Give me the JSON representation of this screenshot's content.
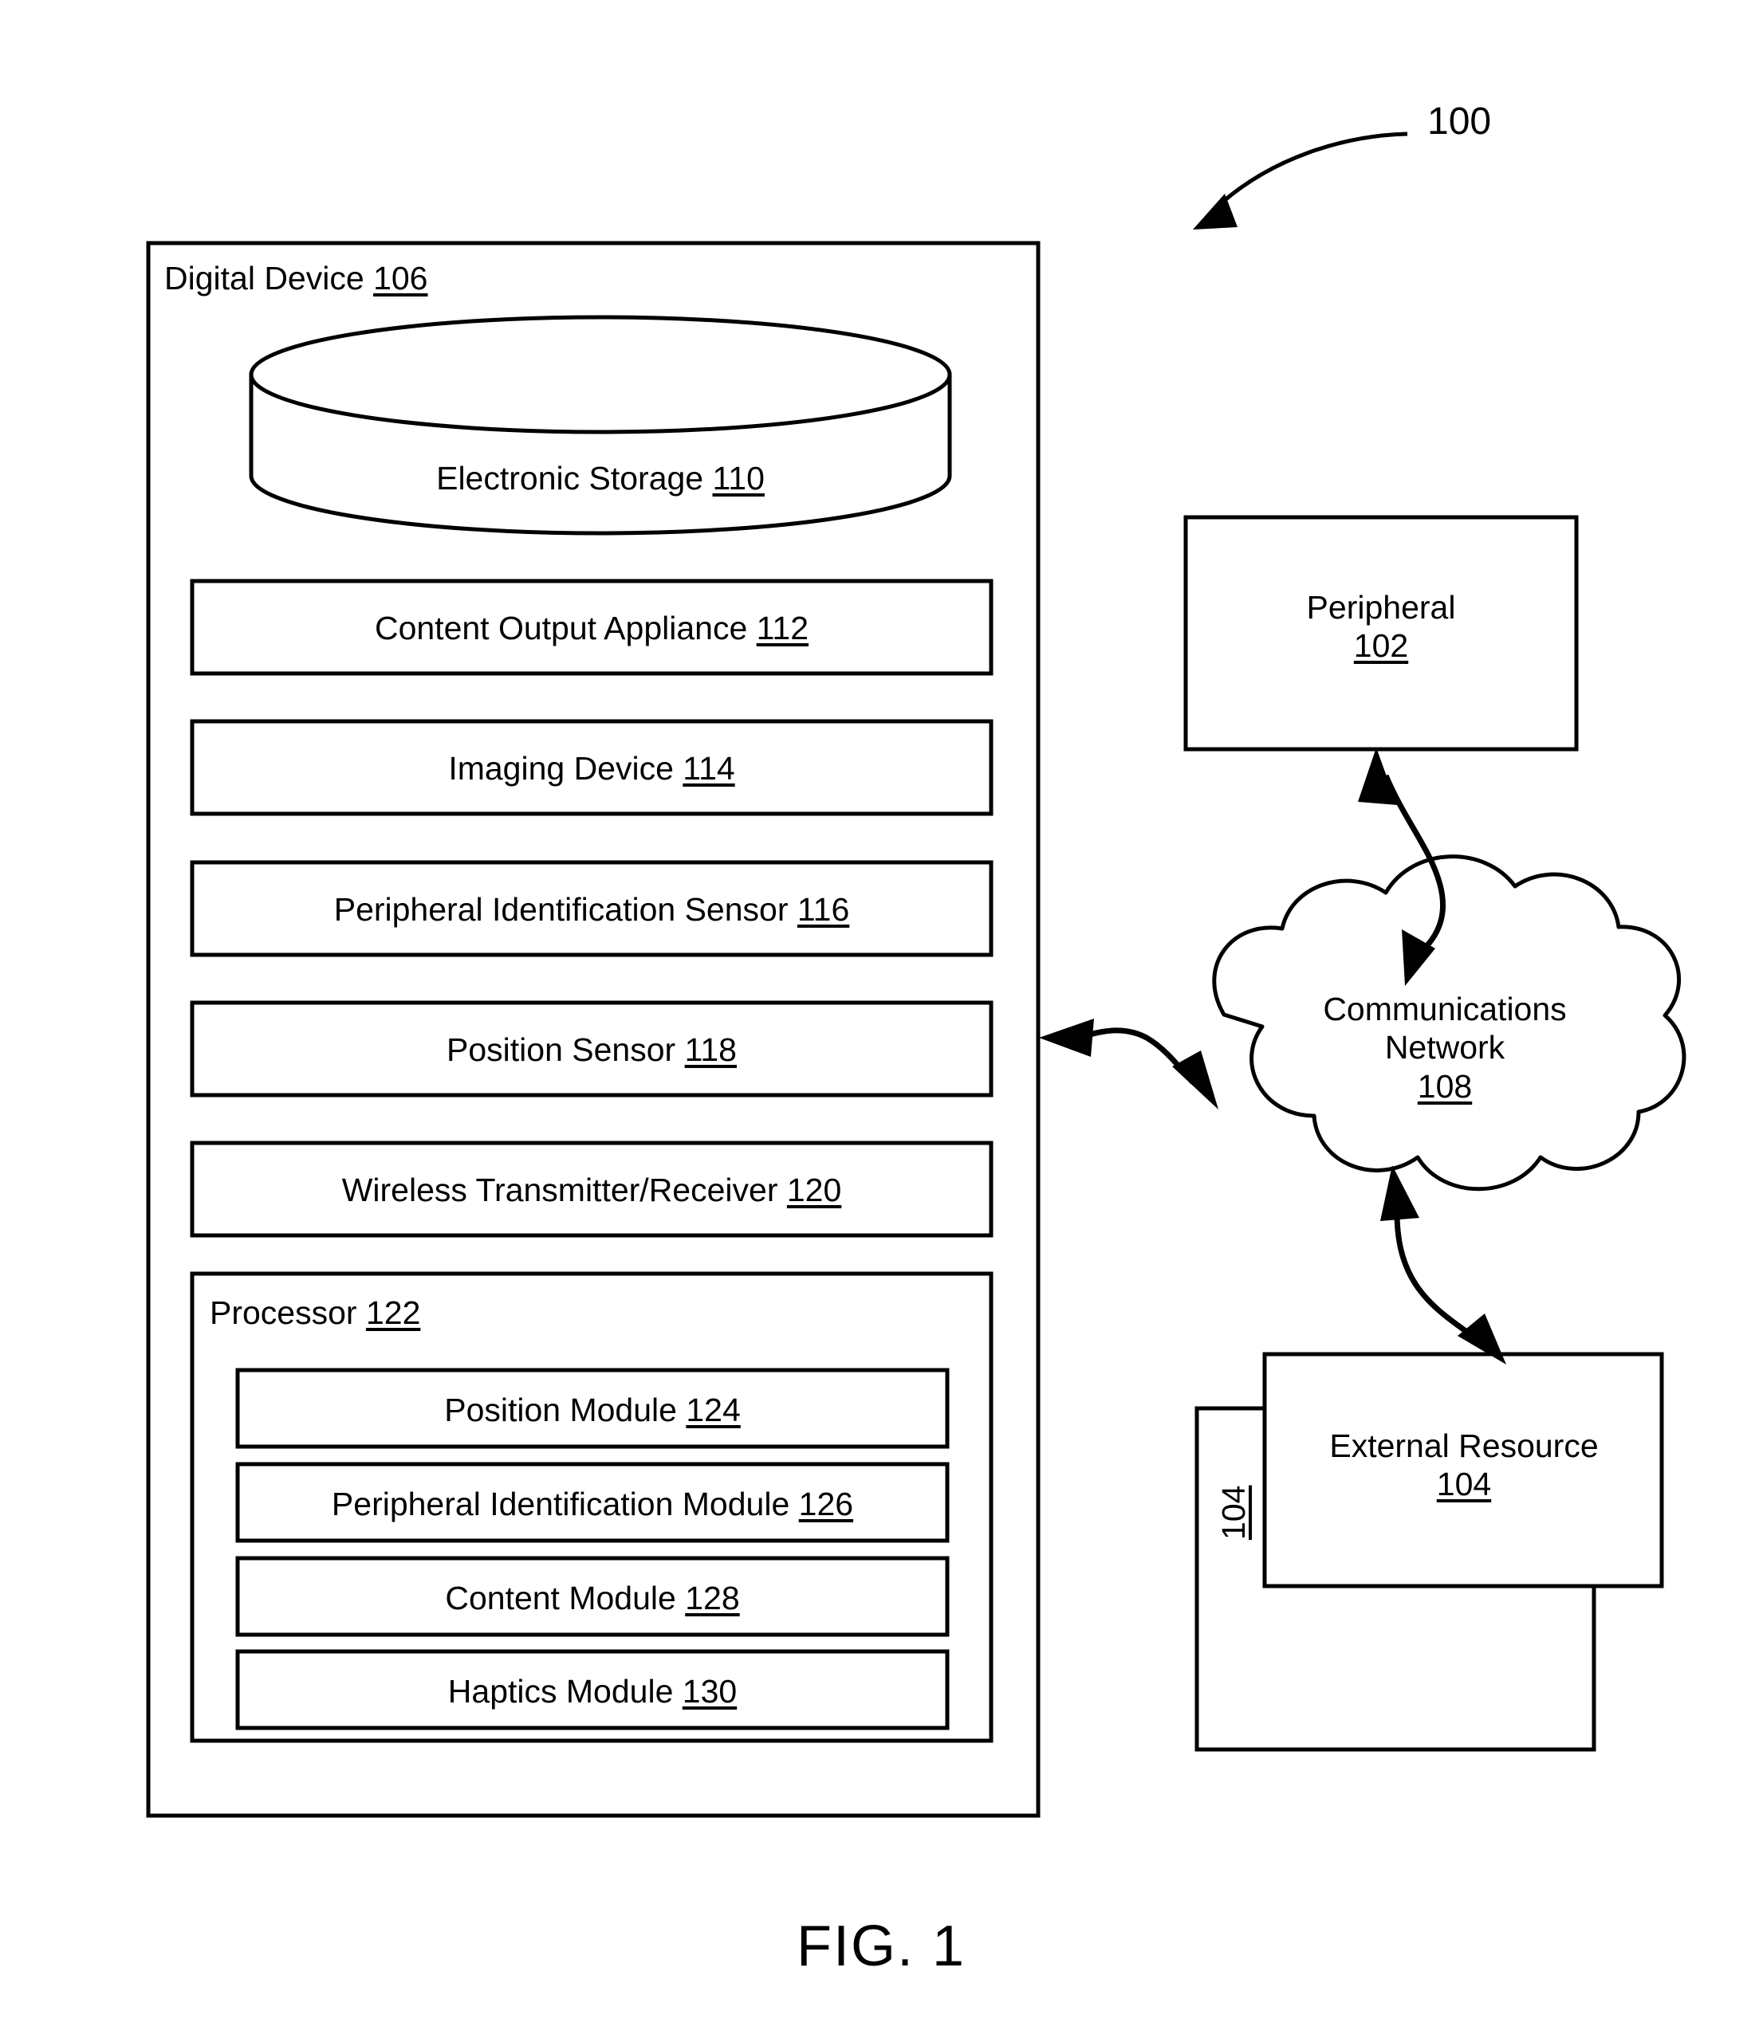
{
  "figure": {
    "caption": "FIG. 1",
    "system_callout": "100"
  },
  "digital_device": {
    "title_text": "Digital Device",
    "title_ref": "106",
    "storage": {
      "label": "Electronic Storage",
      "ref": "110",
      "shape": "cylinder"
    },
    "components": [
      {
        "label": "Content Output Appliance",
        "ref": "112"
      },
      {
        "label": "Imaging Device",
        "ref": "114"
      },
      {
        "label": "Peripheral Identification Sensor",
        "ref": "116"
      },
      {
        "label": "Position Sensor",
        "ref": "118"
      },
      {
        "label": "Wireless Transmitter/Receiver",
        "ref": "120"
      }
    ],
    "processor": {
      "title_text": "Processor",
      "title_ref": "122",
      "modules": [
        {
          "label": "Position Module",
          "ref": "124"
        },
        {
          "label": "Peripheral Identification Module",
          "ref": "126"
        },
        {
          "label": "Content Module",
          "ref": "128"
        },
        {
          "label": "Haptics Module",
          "ref": "130"
        }
      ]
    }
  },
  "peripheral": {
    "label": "Peripheral",
    "ref": "102"
  },
  "network": {
    "label_line1": "Communications",
    "label_line2": "Network",
    "ref": "108",
    "shape": "cloud"
  },
  "external_resource": {
    "label": "External Resource",
    "ref": "104",
    "back_card_ref": "104"
  },
  "connectors": [
    {
      "name": "device-to-network",
      "type": "double-arrow"
    },
    {
      "name": "peripheral-to-network",
      "type": "double-arrow"
    },
    {
      "name": "network-to-external-resource",
      "type": "double-arrow"
    }
  ]
}
